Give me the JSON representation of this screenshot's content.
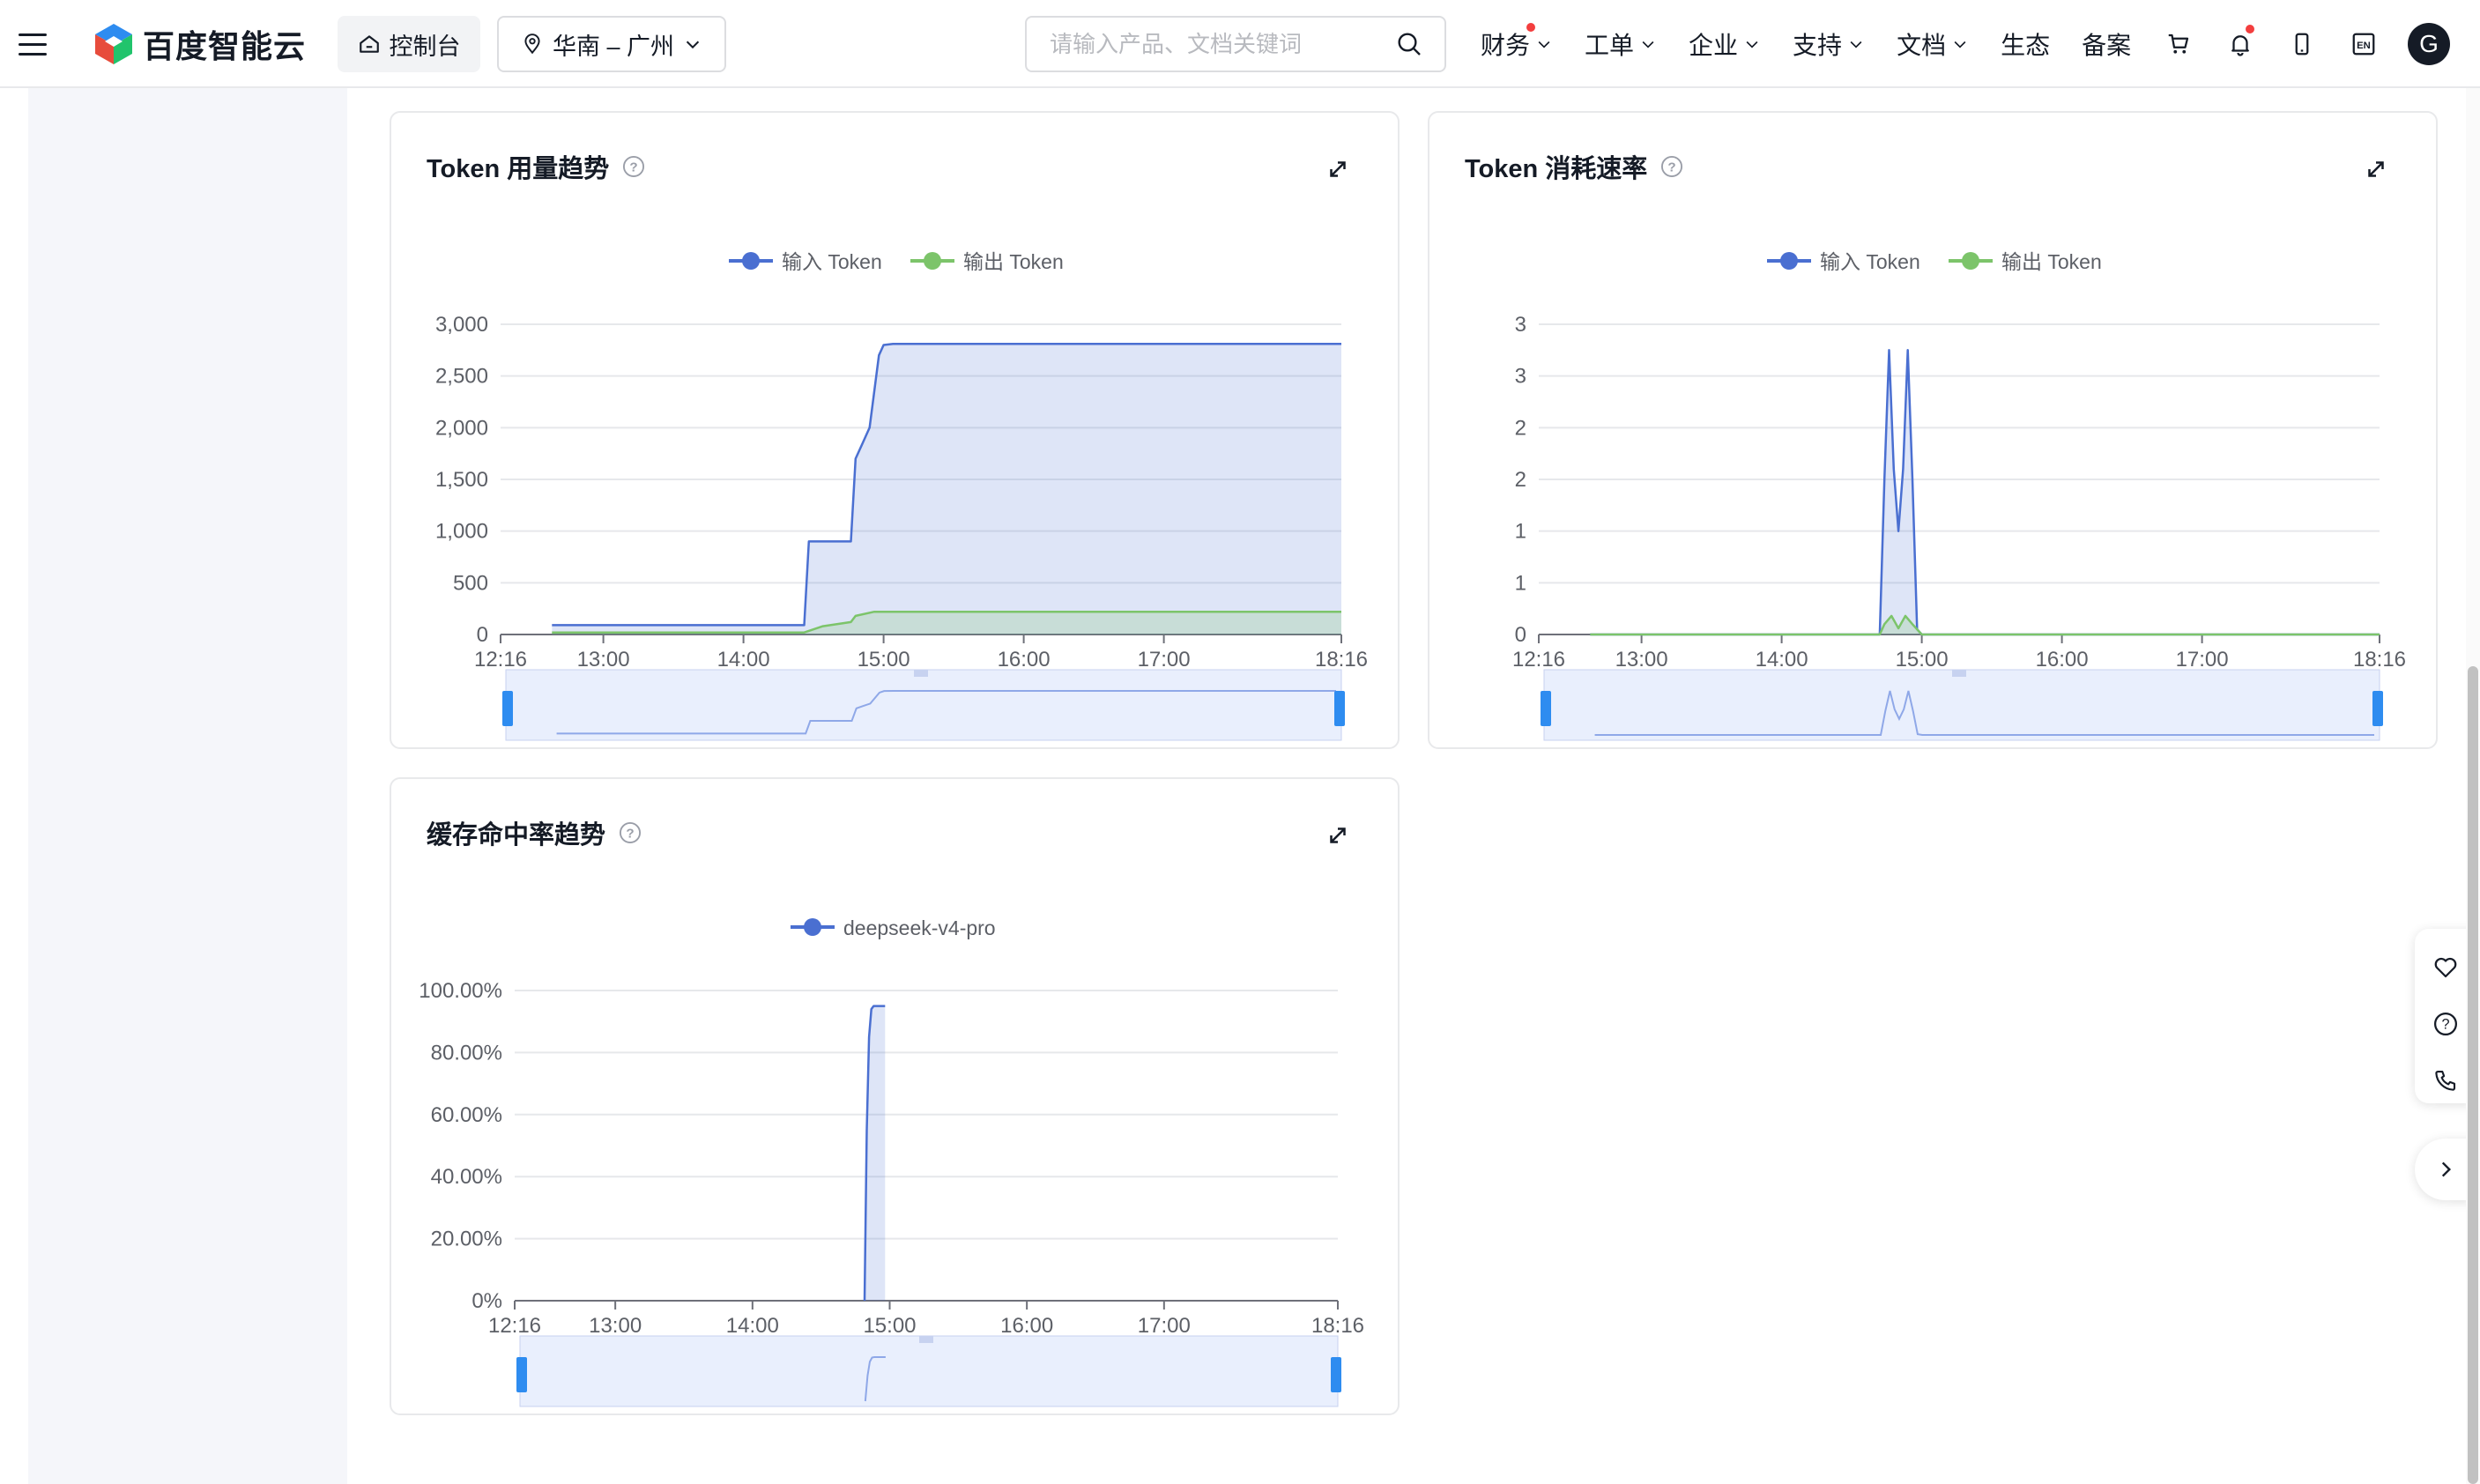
{
  "header": {
    "logo_text": "百度智能云",
    "console_label": "控制台",
    "region_label": "华南 – 广州",
    "search_placeholder": "请输入产品、文档关键词",
    "nav": [
      {
        "label": "财务",
        "has_dropdown": true,
        "has_dot": true
      },
      {
        "label": "工单",
        "has_dropdown": true,
        "has_dot": false
      },
      {
        "label": "企业",
        "has_dropdown": true,
        "has_dot": false
      },
      {
        "label": "支持",
        "has_dropdown": true,
        "has_dot": false
      },
      {
        "label": "文档",
        "has_dropdown": true,
        "has_dot": false
      },
      {
        "label": "生态",
        "has_dropdown": false,
        "has_dot": false
      },
      {
        "label": "备案",
        "has_dropdown": false,
        "has_dot": false
      }
    ],
    "icons": [
      "cart-icon",
      "bell-icon",
      "phone-icon",
      "en-language-icon"
    ],
    "lang_label": "EN",
    "avatar_initial": "G"
  },
  "colors": {
    "input_series": "#4a6fd1",
    "output_series": "#7cc46a",
    "area_fill": "#dbe4fb",
    "notification_dot": "#f33e3e",
    "zoom_handle": "#2e8cf0"
  },
  "float_bar": {
    "icons": [
      "heart-icon",
      "help-icon",
      "phone-call-icon"
    ],
    "next_icon": "chevron-right-icon"
  },
  "chart_data": [
    {
      "id": "usage",
      "type": "area",
      "title": "Token 用量趋势",
      "legend": [
        "输入 Token",
        "输出 Token"
      ],
      "x_ticks": [
        "12:16",
        "13:00",
        "14:00",
        "15:00",
        "16:00",
        "17:00",
        "18:16"
      ],
      "x_range_min": [
        0,
        360
      ],
      "y_ticks": [
        "0",
        "500",
        "1,000",
        "1,500",
        "2,000",
        "2,500",
        "3,000"
      ],
      "ylim": [
        0,
        3000
      ],
      "series": [
        {
          "name": "输入 Token",
          "x": [
            22,
            130,
            132,
            150,
            152,
            155,
            158,
            162,
            164,
            168,
            360
          ],
          "values": [
            90,
            90,
            900,
            900,
            1700,
            1850,
            2000,
            2700,
            2800,
            2810,
            2810
          ]
        },
        {
          "name": "输出 Token",
          "x": [
            22,
            130,
            138,
            150,
            152,
            160,
            360
          ],
          "values": [
            20,
            20,
            80,
            120,
            180,
            220,
            220
          ]
        }
      ],
      "zoom_range": [
        "12:16",
        "18:16"
      ]
    },
    {
      "id": "rate",
      "type": "line",
      "title": "Token 消耗速率",
      "legend": [
        "输入 Token",
        "输出 Token"
      ],
      "x_ticks": [
        "12:16",
        "13:00",
        "14:00",
        "15:00",
        "16:00",
        "17:00",
        "18:16"
      ],
      "x_range_min": [
        0,
        360
      ],
      "y_ticks": [
        "0",
        "1",
        "1",
        "2",
        "2",
        "3",
        "3"
      ],
      "ylim": [
        0,
        3
      ],
      "series": [
        {
          "name": "输入 Token",
          "x": [
            22,
            146,
            148,
            150,
            152,
            154,
            156,
            158,
            160,
            162,
            164,
            360
          ],
          "values": [
            0,
            0,
            1.5,
            2.75,
            1.6,
            1.0,
            1.6,
            2.75,
            1.5,
            0.05,
            0,
            0
          ]
        },
        {
          "name": "输出 Token",
          "x": [
            22,
            146,
            148,
            151,
            154,
            157,
            160,
            164,
            360
          ],
          "values": [
            0,
            0,
            0.1,
            0.18,
            0.06,
            0.18,
            0.1,
            0,
            0
          ]
        }
      ],
      "zoom_range": [
        "12:16",
        "18:16"
      ]
    },
    {
      "id": "cache",
      "type": "area",
      "title": "缓存命中率趋势",
      "legend": [
        "deepseek-v4-pro"
      ],
      "x_ticks": [
        "12:16",
        "13:00",
        "14:00",
        "15:00",
        "16:00",
        "17:00",
        "18:16"
      ],
      "x_range_min": [
        0,
        360
      ],
      "y_ticks": [
        "0%",
        "20.00%",
        "40.00%",
        "60.00%",
        "80.00%",
        "100.00%"
      ],
      "ylim": [
        0,
        100
      ],
      "series": [
        {
          "name": "deepseek-v4-pro",
          "x": [
            153,
            154,
            155,
            156,
            157,
            162
          ],
          "values": [
            0,
            55,
            85,
            94,
            95,
            95
          ]
        }
      ],
      "zoom_range": [
        "12:16",
        "18:16"
      ]
    }
  ]
}
